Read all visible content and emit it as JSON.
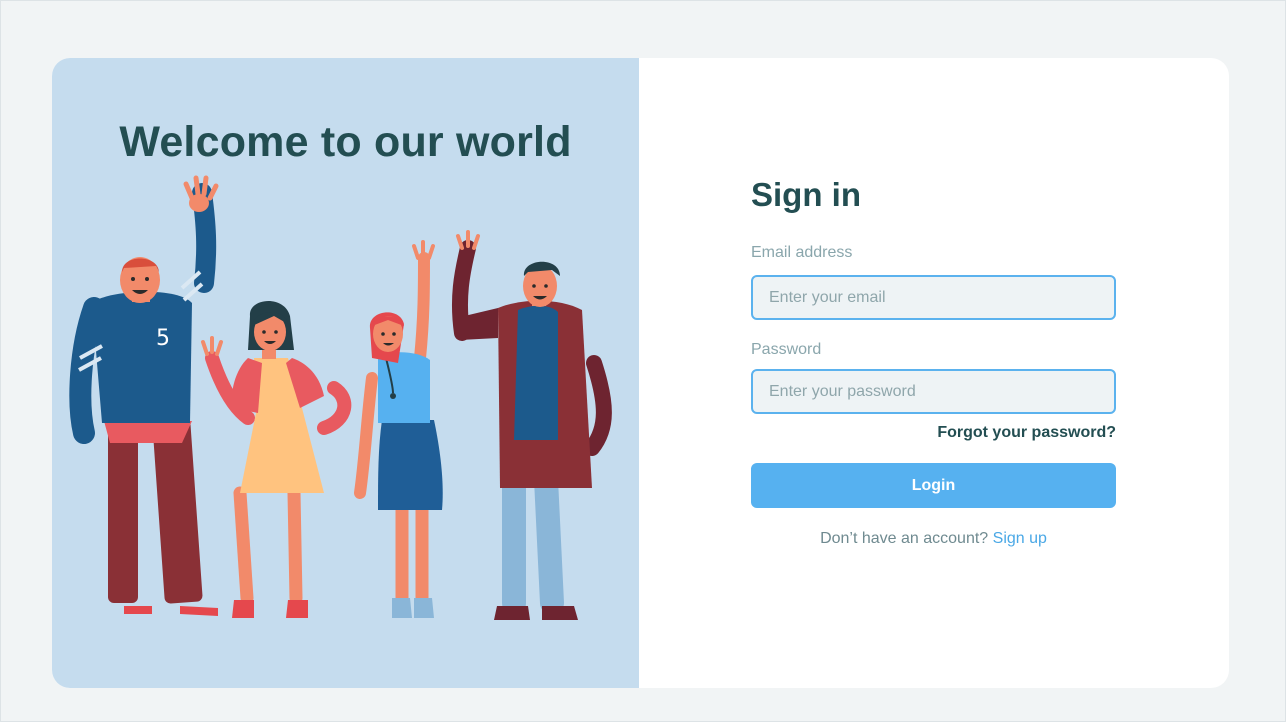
{
  "welcome_panel": {
    "heading": "Welcome to our world",
    "illustration": "group-of-four-people-waving",
    "jersey_number": "5",
    "background_color": "#c5dcee"
  },
  "signin": {
    "title": "Sign in",
    "email": {
      "label": "Email address",
      "placeholder": "Enter your email",
      "value": ""
    },
    "password": {
      "label": "Password",
      "placeholder": "Enter your password",
      "value": ""
    },
    "forgot_link": "Forgot your password?",
    "login_button": "Login",
    "signup_prompt": "Don’t have an account?",
    "signup_link": "Sign up"
  },
  "colors": {
    "heading": "#234e52",
    "accent": "#56b1f0",
    "link": "#4aa8e6",
    "page_background": "#f1f4f5"
  }
}
